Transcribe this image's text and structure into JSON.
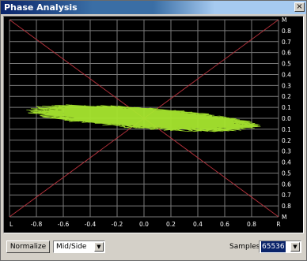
{
  "window": {
    "title": "Phase Analysis",
    "close_label": "×"
  },
  "plot": {
    "right_scale": [
      "M",
      "0.8",
      "0.7",
      "0.6",
      "0.5",
      "0.4",
      "0.3",
      "0.2",
      "0.1",
      "0.0",
      "0.1",
      "0.2",
      "0.3",
      "0.4",
      "0.5",
      "0.6",
      "0.7",
      "0.8",
      "M"
    ],
    "bottom_scale": [
      "L",
      "-0.8",
      "-0.6",
      "-0.4",
      "-0.2",
      "0.0",
      "0.2",
      "0.4",
      "0.6",
      "0.8",
      "R"
    ],
    "colors": {
      "background": "#000000",
      "grid": "#7a7a7a",
      "diagonal": "#b0303a",
      "trace": "#a6e62e",
      "axis_text": "#ffffff"
    }
  },
  "controls": {
    "normalize_label": "Normalize",
    "mode_value": "Mid/Side",
    "samples_label": "Samples",
    "samples_value": "65536",
    "dropdown_icon": "triangle-down-icon"
  }
}
